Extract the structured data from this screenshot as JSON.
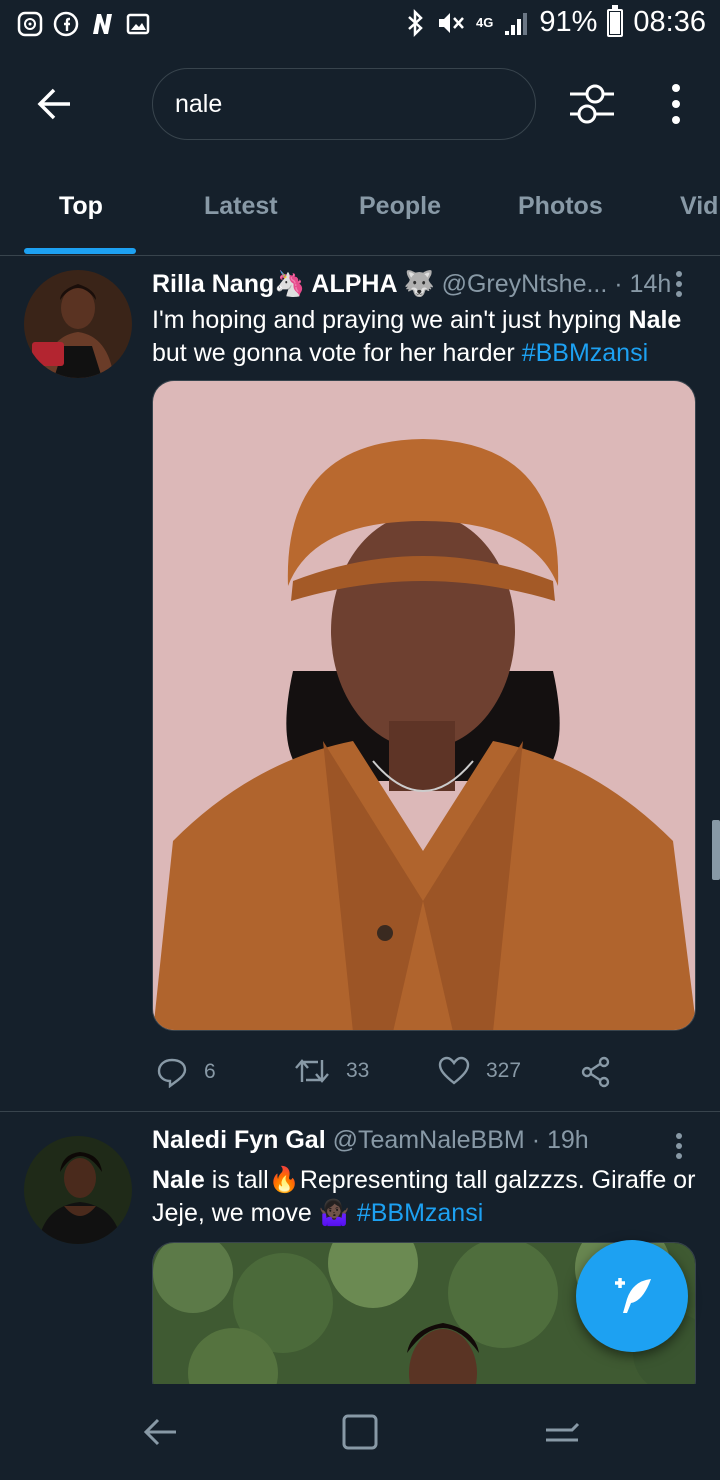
{
  "status_bar": {
    "battery": "91%",
    "time": "08:36",
    "network": "4G",
    "battery_level": 0.91
  },
  "search": {
    "query": "nale"
  },
  "tabs": [
    {
      "label": "Top",
      "active": true
    },
    {
      "label": "Latest",
      "active": false
    },
    {
      "label": "People",
      "active": false
    },
    {
      "label": "Photos",
      "active": false
    },
    {
      "label": "Vid",
      "active": false
    }
  ],
  "tweets": [
    {
      "name": "Rilla Nang🦄 ALPHA 🐺",
      "handle": "@GreyNtshe...",
      "time": "· 14h",
      "text_before": "I'm hoping and praying we ain't just hyping ",
      "text_bold": "Nale",
      "text_after": " but we gonna vote for her harder ",
      "hashtag": "#BBMzansi",
      "replies": "6",
      "retweets": "33",
      "likes": "327"
    },
    {
      "name": "Naledi Fyn Gal",
      "handle": "@TeamNaleBBM",
      "time": "· 19h",
      "text_bold": "Nale",
      "text_after": " is tall🔥Representing tall galzzzs. Giraffe or Jeje, we move 🤷🏿‍♀️ ",
      "hashtag": "#BBMzansi"
    }
  ],
  "colors": {
    "background": "#15202b",
    "accent": "#1da1f2",
    "muted_text": "#8899a6",
    "border": "#38444d"
  }
}
